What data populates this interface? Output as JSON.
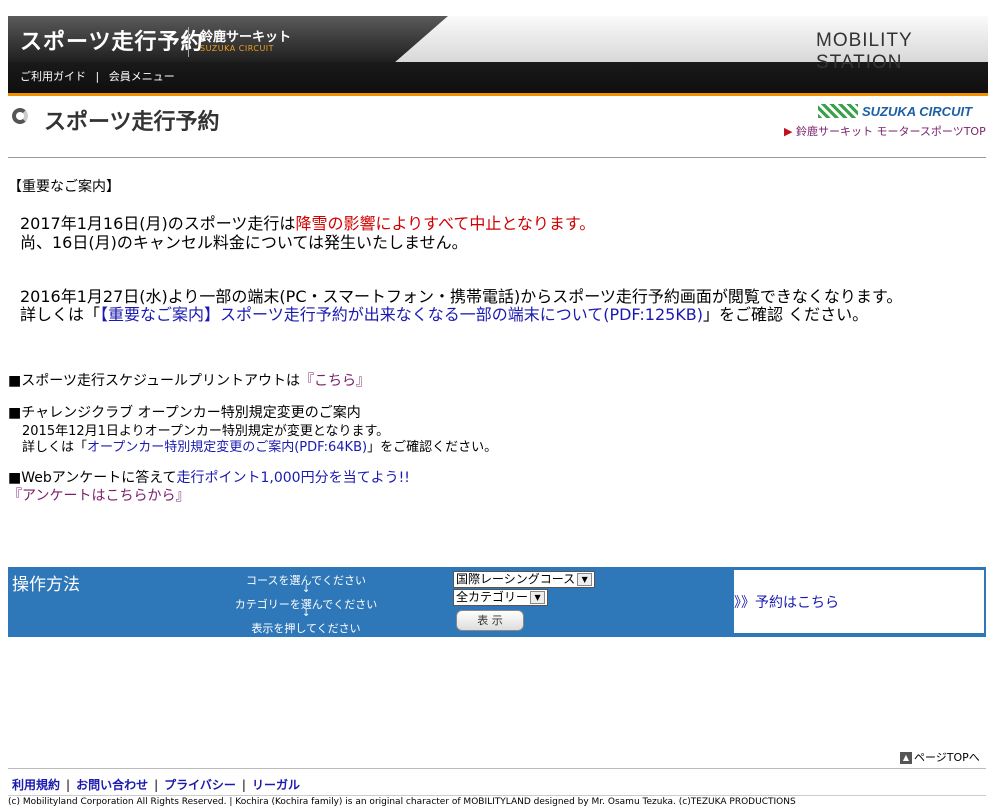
{
  "header": {
    "title": "スポーツ走行予約",
    "circuit_jp": "鈴鹿サーキット",
    "circuit_en": "SUZUKA CIRCUIT",
    "brand": "MOBILITY STATION",
    "nav": [
      "ご利用ガイド",
      "会員メニュー"
    ],
    "nav_sep": "|"
  },
  "page": {
    "title": "スポーツ走行予約",
    "logo_text": "SUZUKA CIRCUIT",
    "top_link": "鈴鹿サーキット モータースポーツTOP",
    "top_link_arrow": "▶"
  },
  "notices": {
    "heading": "【重要なご案内】",
    "n1_a": "2017年1月16日(月)のスポーツ走行は",
    "n1_red": "降雪の影響によりすべて中止となります。",
    "n1_b": "尚、16日(月)のキャンセル料金については発生いたしません。",
    "n2_a": "2016年1月27日(水)より一部の端末(PC・スマートフォン・携帯電話)からスポーツ走行予約画面が閲覧できなくなります。",
    "n2_pre": "詳しくは「",
    "n2_link": "【重要なご案内】スポーツ走行予約が出来なくなる一部の端末について(PDF:125KB)",
    "n2_post": "」をご確認 ください。"
  },
  "info": {
    "schedule_pre": "■スポーツ走行スケジュールプリントアウトは",
    "schedule_link": "『こちら』",
    "challenge_title": "■チャレンジクラブ オープンカー特別規定変更のご案内",
    "challenge_line": "2015年12月1日よりオープンカー特別規定が変更となります。",
    "challenge_pre": "詳しくは「",
    "challenge_link": "オープンカー特別規定変更のご案内(PDF:64KB)",
    "challenge_post": "」をご確認ください。",
    "survey_pre": "■Webアンケートに答えて",
    "survey_blue": "走行ポイント1,000円分を当てよう!!",
    "survey_link": "『アンケートはこちらから』"
  },
  "operation": {
    "title": "操作方法",
    "step1": "コースを選んでください",
    "step2": "カテゴリーを選んでください",
    "step3": "表示を押してください",
    "arrow": "↓",
    "course_value": "国際レーシングコース",
    "category_value": "全カテゴリー",
    "chev": "▼",
    "show_button": "表 示",
    "reserve_link": "》》予約はこちら"
  },
  "footer": {
    "page_top": "ページTOPへ",
    "page_top_icon": "▲",
    "links": [
      "利用規約",
      "お問い合わせ",
      "プライバシー",
      "リーガル"
    ],
    "sep": "|",
    "copyright": "(c) Mobilityland Corporation All Rights Reserved. | Kochira (Kochira family) is an original character of MOBILITYLAND designed by Mr. Osamu Tezuka. (c)TEZUKA PRODUCTIONS"
  },
  "colors": {
    "accent_orange": "#f29100",
    "panel_blue": "#2e77b8",
    "alert_red": "#d00000",
    "link_blue": "#1a1ab0",
    "link_purple": "#7a1f6b"
  }
}
